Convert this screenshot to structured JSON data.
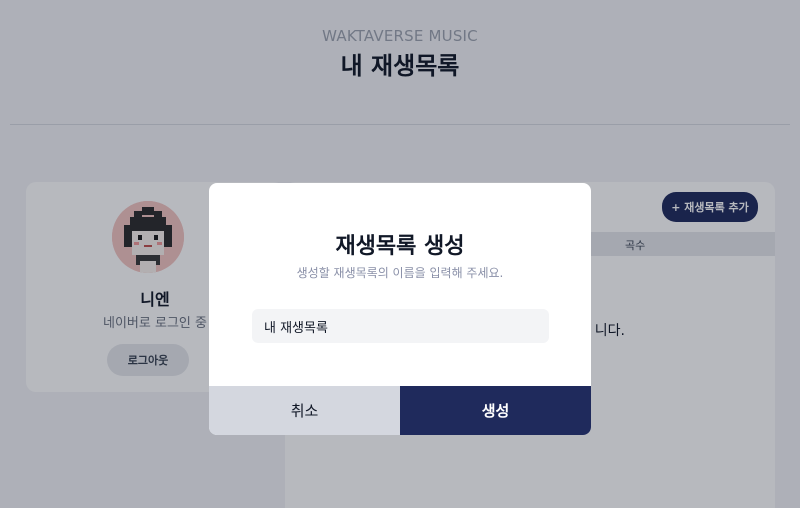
{
  "header": {
    "brand": "WAKTAVERSE MUSIC",
    "title": "내 재생목록"
  },
  "profile": {
    "name": "니엔",
    "login_status": "네이버로 로그인 중",
    "logout_label": "로그아웃",
    "avatar_icon": "pixel-character-avatar"
  },
  "playlist_panel": {
    "add_button_label": "+ 재생목록 추가",
    "columns": [
      "곡수"
    ],
    "empty_message_visible_fragment": "니다."
  },
  "modal": {
    "title": "재생목록 생성",
    "description": "생성할 재생목록의 이름을 입력해 주세요.",
    "input_value": "내 재생목록",
    "cancel_label": "취소",
    "create_label": "생성"
  },
  "colors": {
    "accent": "#1f2a5c",
    "cancel_bg": "#d4d7df",
    "input_bg": "#f3f4f6",
    "overlay": "rgba(17,24,39,0.30)"
  }
}
